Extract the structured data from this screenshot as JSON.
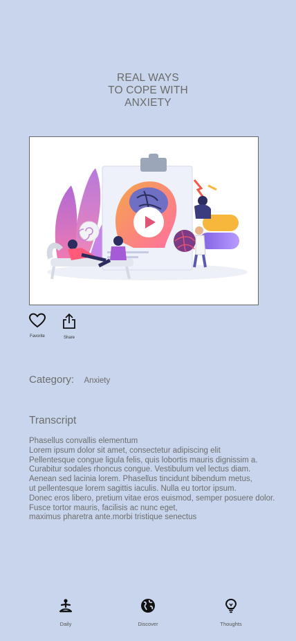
{
  "header": {
    "title_lines": [
      "REAL WAYS",
      "TO COPE WITH",
      "ANXIETY"
    ]
  },
  "video": {
    "play_icon": "play-icon"
  },
  "actions": {
    "favorite_label": "Favorite",
    "share_label": "Share"
  },
  "category": {
    "label": "Category:",
    "value": "Anxiety"
  },
  "transcript": {
    "heading": "Transcript",
    "lines": [
      "Phasellus convallis elementum",
      "Lorem ipsum dolor sit amet, consectetur adipiscing elit",
      "Pellentesque congue ligula felis, quis lobortis mauris dignissim a.",
      "Curabitur sodales rhoncus congue. Vestibulum vel lectus diam.",
      "Aenean sed lacinia lorem. Phasellus tincidunt bibendum metus,",
      "ut pellentesque lorem sagittis iaculis. Nulla eu tortor ipsum.",
      "Donec eros libero, pretium vitae eros euismod, semper posuere dolor.",
      "Fusce tortor mauris, facilisis ac nunc eget,",
      "maximus pharetra ante.morbi tristique senectus"
    ]
  },
  "bottom_nav": {
    "items": [
      {
        "label": "Daily",
        "icon": "meditation-icon"
      },
      {
        "label": "Discover",
        "icon": "globe-icon"
      },
      {
        "label": "Thoughts",
        "icon": "lightbulb-icon"
      }
    ]
  },
  "colors": {
    "background": "#c8d5ec",
    "text": "#6b6b6b",
    "accent": "#e05575"
  }
}
